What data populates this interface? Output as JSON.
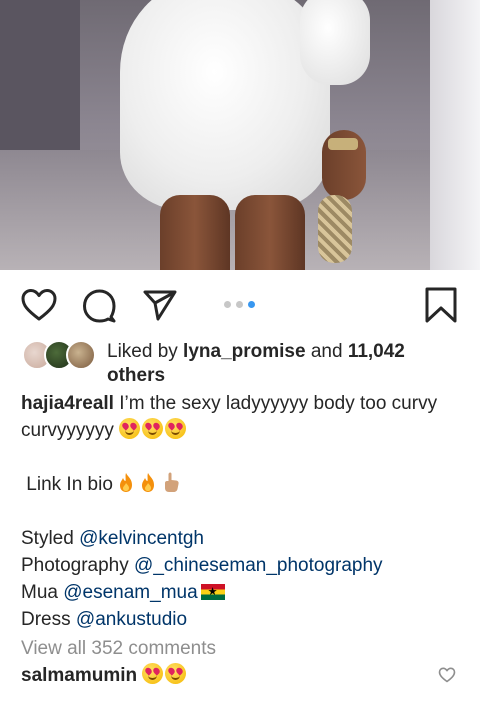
{
  "post": {
    "image_alt": "Photo of a woman in a white dress holding a clutch",
    "carousel": {
      "count": 3,
      "active_index": 2
    }
  },
  "likes": {
    "prefix": "Liked by ",
    "user": "lyna_promise",
    "middle": " and ",
    "count": "11,042",
    "suffix": "others"
  },
  "caption": {
    "user": "hajia4reall",
    "text": " I’m the sexy ladyyyyyy body too curvy curvyyyyyy ",
    "link_in_bio": "Link In bio ",
    "styled_label": "Styled ",
    "styled_handle": "@kelvincentgh",
    "photo_label": "Photography ",
    "photo_handle": "@_chineseman_photography",
    "mua_label": "Mua ",
    "mua_handle": "@esenam_mua",
    "dress_label": "Dress ",
    "dress_handle": "@ankustudio"
  },
  "comments": {
    "view_all": "View all 352 comments",
    "first_user": "salmamumin"
  },
  "icons": {
    "like": "heart-icon",
    "comment": "comment-icon",
    "share": "send-icon",
    "save": "bookmark-icon"
  },
  "colors": {
    "link": "#003569",
    "muted": "#8e8e8e",
    "dot_active": "#3897f0"
  }
}
